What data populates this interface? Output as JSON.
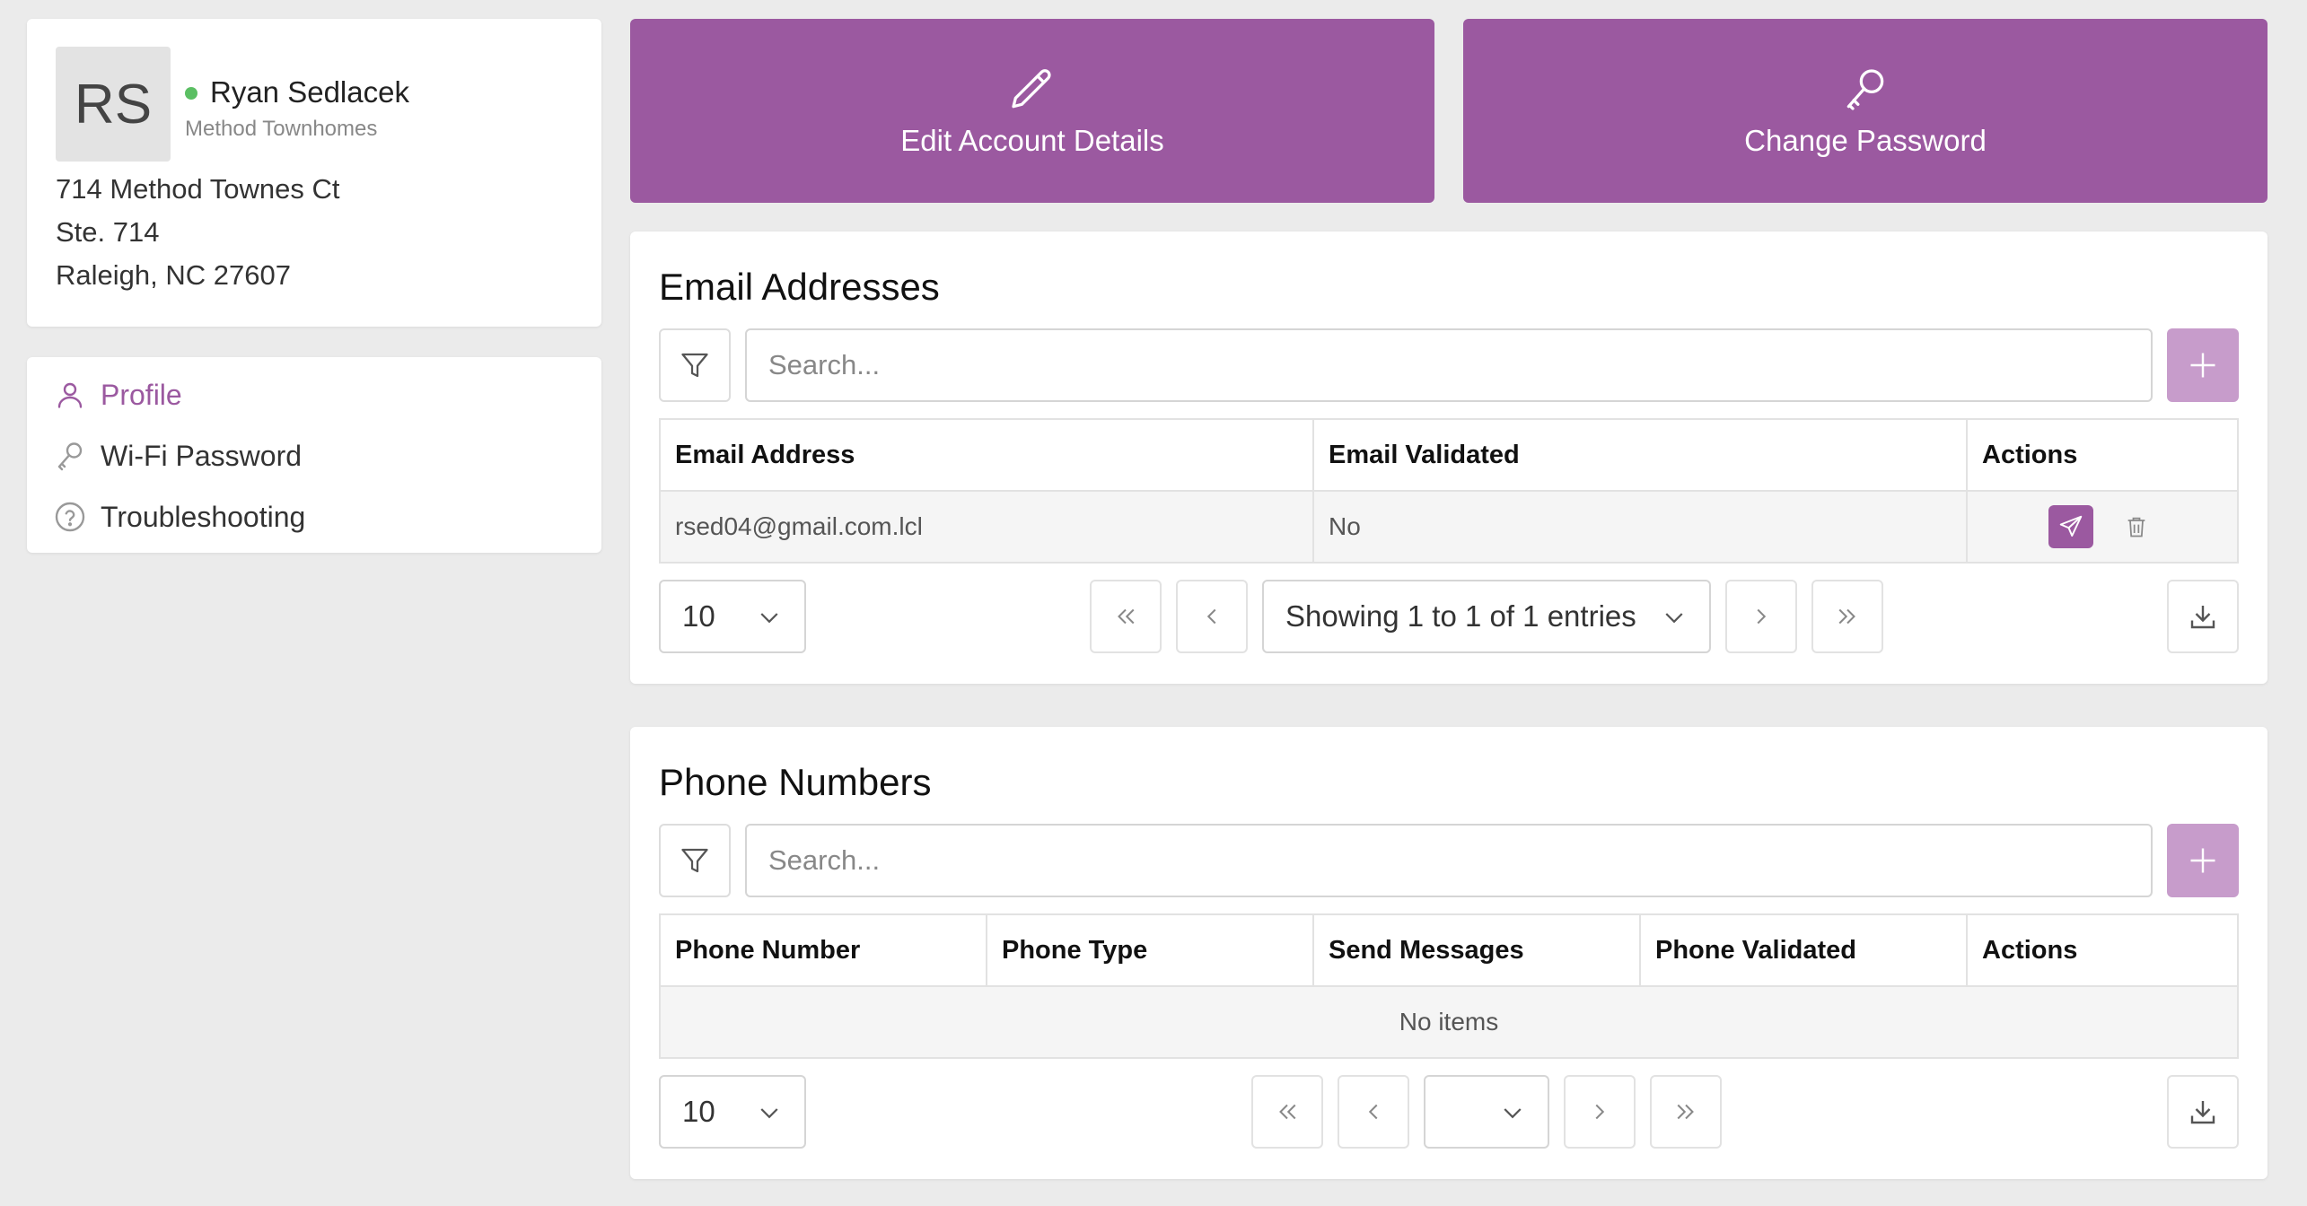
{
  "profile": {
    "initials": "RS",
    "name": "Ryan Sedlacek",
    "org": "Method Townhomes",
    "address_line1": "714 Method Townes Ct",
    "address_line2": "Ste. 714",
    "address_line3": "Raleigh, NC 27607",
    "status_color": "#5bbf63"
  },
  "nav": {
    "items": [
      {
        "label": "Profile",
        "icon": "user-icon",
        "active": true
      },
      {
        "label": "Wi-Fi Password",
        "icon": "key-icon",
        "active": false
      },
      {
        "label": "Troubleshooting",
        "icon": "help-circle-icon",
        "active": false
      }
    ]
  },
  "actions": {
    "edit_label": "Edit Account Details",
    "password_label": "Change Password"
  },
  "email_section": {
    "title": "Email Addresses",
    "search_placeholder": "Search...",
    "columns": [
      "Email Address",
      "Email Validated",
      "Actions"
    ],
    "rows": [
      {
        "email": "rsed04@gmail.com.lcl",
        "validated": "No"
      }
    ],
    "page_size": "10",
    "page_info": "Showing 1 to 1 of 1 entries"
  },
  "phone_section": {
    "title": "Phone Numbers",
    "search_placeholder": "Search...",
    "columns": [
      "Phone Number",
      "Phone Type",
      "Send Messages",
      "Phone Validated",
      "Actions"
    ],
    "empty_text": "No items",
    "page_size": "10",
    "page_info": ""
  },
  "colors": {
    "accent": "#9b59a0",
    "accent_light": "#c79ccb",
    "background": "#ebebeb"
  }
}
